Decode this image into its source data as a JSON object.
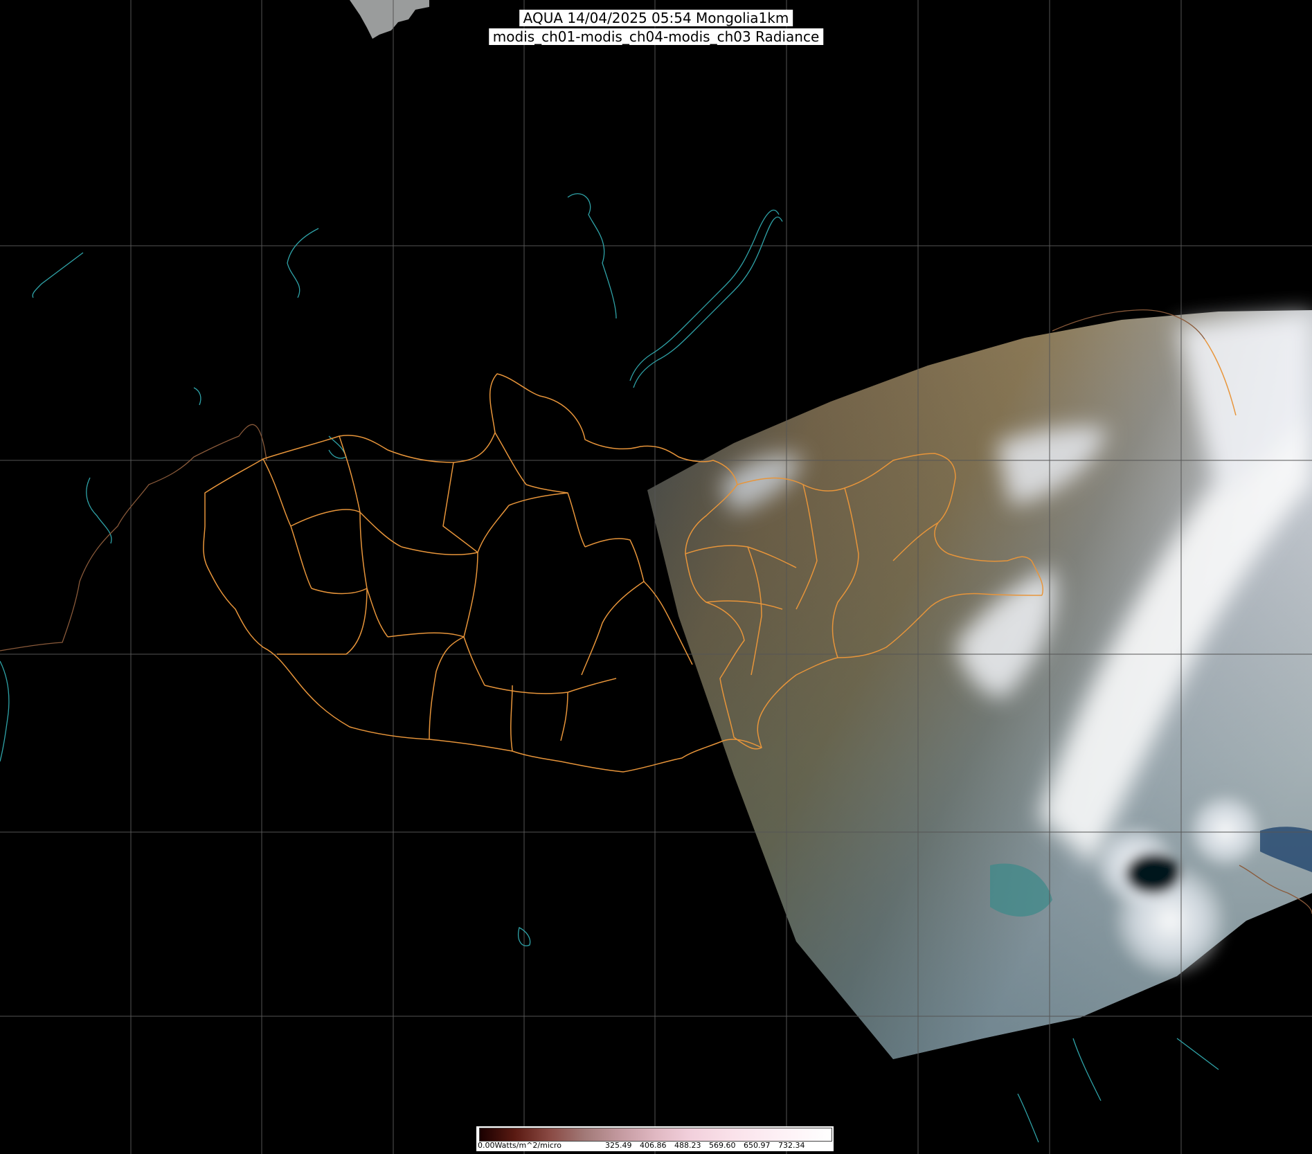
{
  "title": {
    "line1": "AQUA 14/04/2025 05:54 Mongolia1km",
    "line2": "modis_ch01-modis_ch04-modis_ch03 Radiance"
  },
  "legend": {
    "unit_label": "0.00Watts/m^2/micro",
    "ticks": [
      "325.49",
      "406.86",
      "488.23",
      "569.60",
      "650.97",
      "732.34"
    ]
  },
  "colors": {
    "background": "#000000",
    "graticule": "#555555",
    "admin_boundary": "#e8953a",
    "coastline": "#2fa3a8",
    "international_border": "#8a5a3a"
  },
  "icons": {
    "satellite_swath": "satellite-swath-icon",
    "map_grid": "graticule-icon"
  }
}
